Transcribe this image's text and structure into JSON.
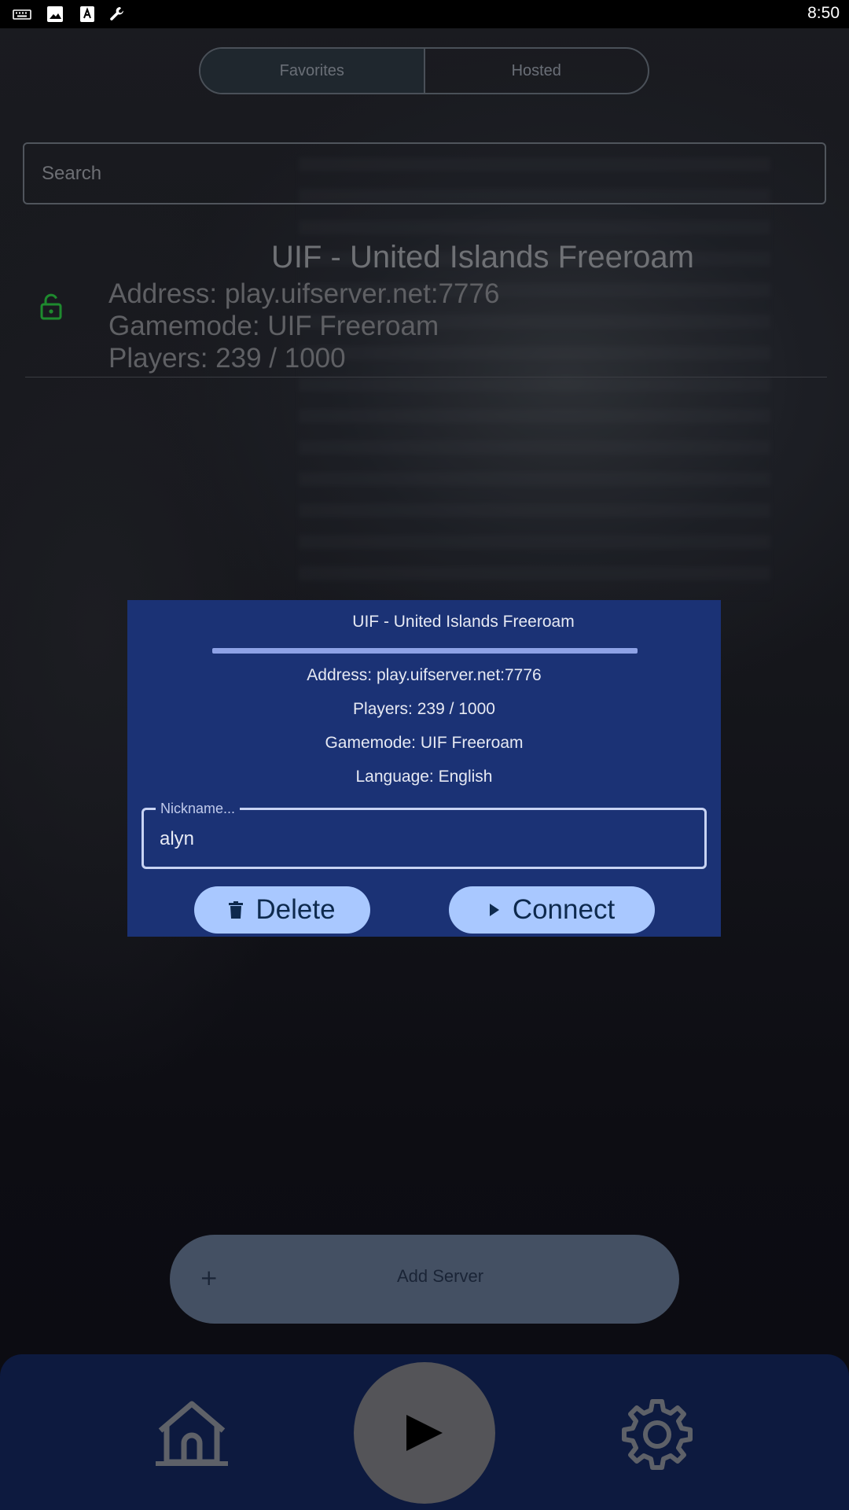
{
  "status_bar": {
    "time": "8:50",
    "icons": [
      "keyboard-icon",
      "image-icon",
      "font-icon",
      "wrench-icon"
    ]
  },
  "tabs": [
    {
      "label": "Favorites",
      "active": true
    },
    {
      "label": "Hosted",
      "active": false
    }
  ],
  "search": {
    "placeholder": "Search"
  },
  "server": {
    "title": "UIF - United Islands Freeroam",
    "address": "Address: play.uifserver.net:7776",
    "gamemode": "Gamemode: UIF Freeroam",
    "players": "Players: 239 / 1000",
    "lock_color": "#1e8a2e"
  },
  "dialog": {
    "title": "UIF - United Islands Freeroam",
    "address": "Address: play.uifserver.net:7776",
    "players": "Players: 239 / 1000",
    "gamemode": "Gamemode: UIF Freeroam",
    "language": "Language: English",
    "nickname_label": "Nickname...",
    "nickname_value": "alyn",
    "delete_label": "Delete",
    "connect_label": "Connect",
    "background_color": "#1b3275",
    "button_color": "#a9c8ff"
  },
  "add_server": {
    "icon": "+",
    "label": "Add Server"
  },
  "bottom_nav": {
    "items": [
      "home-icon",
      "play-icon",
      "settings-icon"
    ],
    "background_color": "#0d1a3f"
  }
}
